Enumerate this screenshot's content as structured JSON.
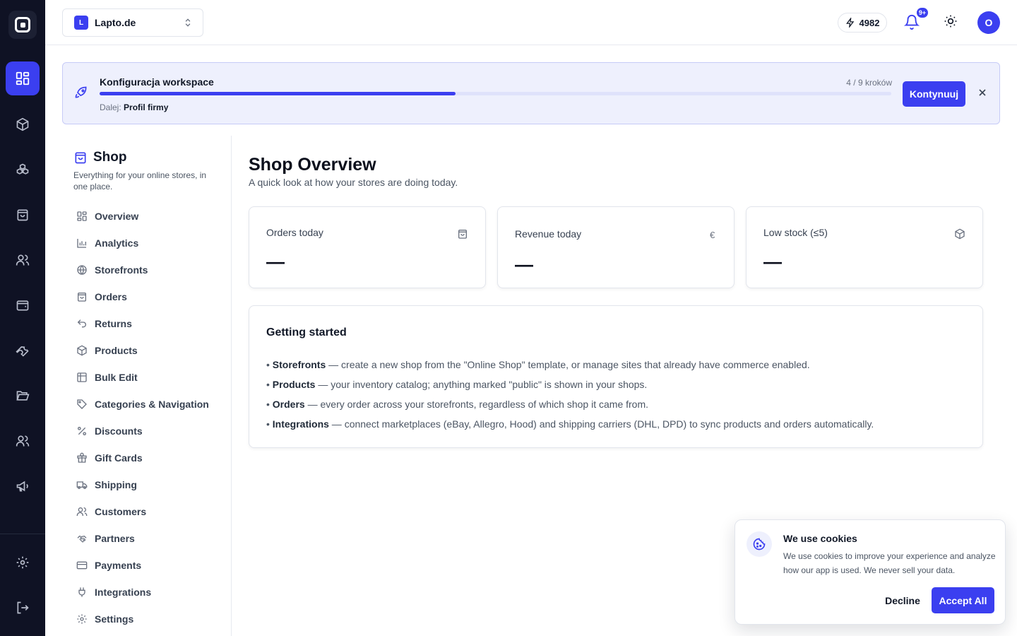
{
  "rail": {
    "items": [
      {
        "icon": "grid-icon",
        "active": true
      },
      {
        "icon": "cube-icon"
      },
      {
        "icon": "boxes-icon"
      },
      {
        "icon": "shopping-bag-icon"
      },
      {
        "icon": "users-icon"
      },
      {
        "icon": "wallet-icon"
      },
      {
        "icon": "wrench-icon"
      },
      {
        "icon": "folder-open-icon"
      },
      {
        "icon": "team-icon"
      },
      {
        "icon": "megaphone-icon"
      },
      {
        "icon": "settings-icon"
      },
      {
        "icon": "logout-icon"
      }
    ]
  },
  "topbar": {
    "workspace_badge": "L",
    "workspace_name": "Lapto.de",
    "credits": "4982",
    "notifications_badge": "9+",
    "avatar_initial": "O"
  },
  "setup": {
    "title": "Konfiguracja workspace",
    "steps": "4 / 9 kroków",
    "progress": 0.45,
    "next_label": "Dalej:",
    "next_value": "Profil firmy",
    "continue_label": "Kontynuuj"
  },
  "subnav": {
    "title": "Shop",
    "description": "Everything for your online stores, in one place.",
    "items": [
      {
        "label": "Overview",
        "icon": "grid-icon"
      },
      {
        "label": "Analytics",
        "icon": "bar-chart-icon"
      },
      {
        "label": "Storefronts",
        "icon": "globe-icon"
      },
      {
        "label": "Orders",
        "icon": "shopping-bag-icon"
      },
      {
        "label": "Returns",
        "icon": "undo-icon"
      },
      {
        "label": "Products",
        "icon": "cube-icon"
      },
      {
        "label": "Bulk Edit",
        "icon": "table-icon"
      },
      {
        "label": "Categories & Navigation",
        "icon": "tag-icon"
      },
      {
        "label": "Discounts",
        "icon": "percent-icon"
      },
      {
        "label": "Gift Cards",
        "icon": "gift-icon"
      },
      {
        "label": "Shipping",
        "icon": "truck-icon"
      },
      {
        "label": "Customers",
        "icon": "users-icon"
      },
      {
        "label": "Partners",
        "icon": "handshake-icon"
      },
      {
        "label": "Payments",
        "icon": "credit-card-icon"
      },
      {
        "label": "Integrations",
        "icon": "plug-icon"
      },
      {
        "label": "Settings",
        "icon": "settings-icon"
      }
    ]
  },
  "main": {
    "title": "Shop Overview",
    "subtitle": "A quick look at how your stores are doing today.",
    "stats": [
      {
        "label": "Orders today",
        "value": "—",
        "icon": "shopping-bag-icon"
      },
      {
        "label": "Revenue today",
        "value": "—",
        "icon": "euro-icon",
        "icon_glyph": "€"
      },
      {
        "label": "Low stock (≤5)",
        "value": "—",
        "icon": "cube-icon"
      }
    ],
    "getting_started": {
      "title": "Getting started",
      "lines": [
        {
          "bullet": "•",
          "term": "Storefronts",
          "text": " — create a new shop from the \"Online Shop\" template, or manage sites that already have commerce enabled."
        },
        {
          "bullet": "•",
          "term": "Products",
          "text": " — your inventory catalog; anything marked \"public\" is shown in your shops."
        },
        {
          "bullet": "•",
          "term": "Orders",
          "text": " — every order across your storefronts, regardless of which shop it came from."
        },
        {
          "bullet": "•",
          "term": "Integrations",
          "text": " — connect marketplaces (eBay, Allegro, Hood) and shipping carriers (DHL, DPD) to sync products and orders automatically."
        }
      ]
    }
  },
  "cookie": {
    "title": "We use cookies",
    "text": "We use cookies to improve your experience and analyze how our app is used. We never sell your data.",
    "decline_label": "Decline",
    "accept_label": "Accept All"
  },
  "colors": {
    "accent": "#3b3ff0",
    "rail_bg": "#0f1224",
    "banner_bg": "#eef0fd"
  }
}
